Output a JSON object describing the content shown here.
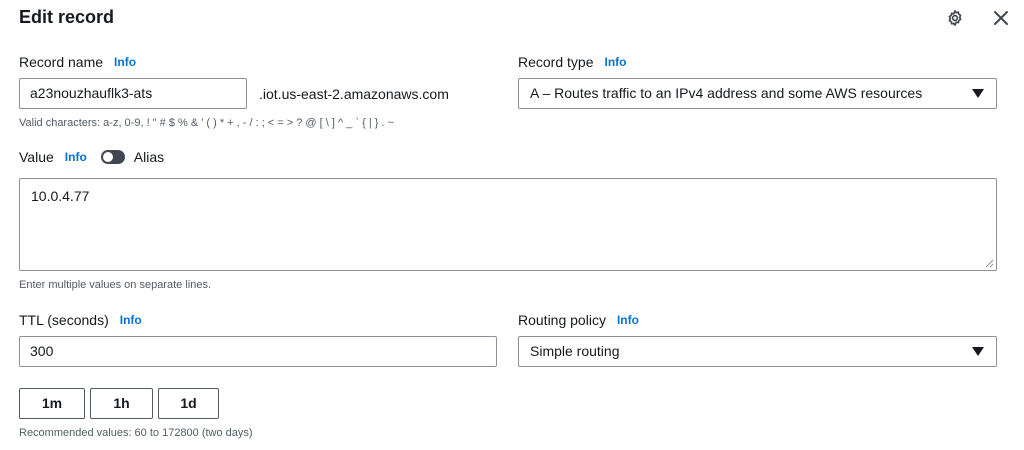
{
  "header": {
    "title": "Edit record",
    "settings_icon": "gear-icon",
    "close_icon": "close-icon"
  },
  "record_name": {
    "label": "Record name",
    "info": "Info",
    "value": "a23nouzhauflk3-ats",
    "suffix": ".iot.us-east-2.amazonaws.com",
    "hint": "Valid characters: a-z, 0-9, ! \" # $ % & ' ( ) * + , - / : ; < = > ? @ [ \\ ] ^ _ ` { | } . ~"
  },
  "record_type": {
    "label": "Record type",
    "info": "Info",
    "selected": "A – Routes traffic to an IPv4 address and some AWS resources"
  },
  "value": {
    "label": "Value",
    "info": "Info",
    "alias_label": "Alias",
    "alias_enabled": false,
    "text": "10.0.4.77",
    "hint": "Enter multiple values on separate lines."
  },
  "ttl": {
    "label": "TTL (seconds)",
    "info": "Info",
    "value": "300",
    "presets": [
      "1m",
      "1h",
      "1d"
    ],
    "hint": "Recommended values: 60 to 172800 (two days)"
  },
  "routing_policy": {
    "label": "Routing policy",
    "info": "Info",
    "selected": "Simple routing"
  },
  "colors": {
    "link": "#0972d3",
    "text": "#16191f",
    "muted": "#545b64",
    "border": "#8d9096",
    "toggle_off": "#414750"
  }
}
